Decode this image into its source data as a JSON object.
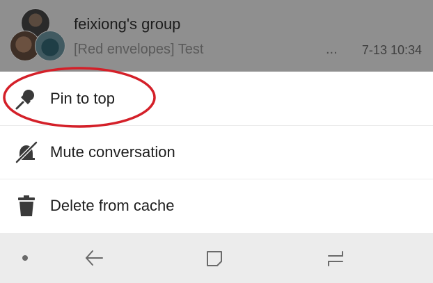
{
  "chat": {
    "title": "feixiong's group",
    "preview": "[Red envelopes] Test",
    "ellipsis": "...",
    "time": "7-13 10:34"
  },
  "menu": {
    "items": [
      {
        "label": "Pin to top",
        "icon": "pin-icon"
      },
      {
        "label": "Mute conversation",
        "icon": "mute-icon"
      },
      {
        "label": "Delete from cache",
        "icon": "trash-icon"
      }
    ]
  },
  "annotation": {
    "color": "#d42029"
  },
  "nav": {
    "items": [
      "dot-icon",
      "back-icon",
      "recents-icon",
      "switch-icon"
    ]
  }
}
